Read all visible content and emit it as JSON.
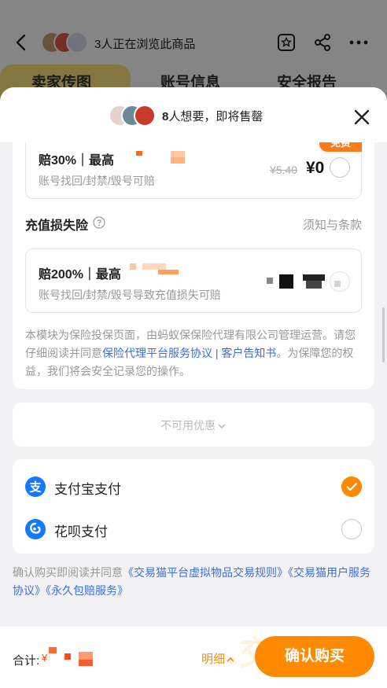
{
  "background_page": {
    "viewers_text": "3人正在浏览此商品",
    "tabs": [
      "卖家传图",
      "账号信息",
      "安全报告"
    ]
  },
  "sheet": {
    "header": {
      "want_count": "8",
      "want_text": "人想要，即将售罄"
    },
    "insurance": {
      "option1": {
        "title": "赔30%｜最高",
        "subtitle": "账号找回/封禁/毁号可赔",
        "badge": "免费",
        "old_price": "¥5.40",
        "new_price": "¥0"
      },
      "section_title": "充值损失险",
      "terms_link": "须知与条款",
      "option2": {
        "title": "赔200%｜最高",
        "subtitle": "账号找回/封禁/毁号导致充值损失可赔"
      },
      "notice_prefix": "本模块为保险投保页面，由蚂蚁保保险代理有限公司管理运营。请您仔细阅读并同意",
      "notice_link": "保险代理平台服务协议 | 客户告知书",
      "notice_suffix": "。为保障您的权益，我们将会安全记录您的操作。"
    },
    "coupon": {
      "label": "不可用优惠",
      "icon": "chevron-down-icon"
    },
    "payment": {
      "methods": [
        {
          "label": "支付宝支付",
          "icon": "alipay-icon",
          "selected": true
        },
        {
          "label": "花呗支付",
          "icon": "huabei-icon",
          "selected": false
        }
      ]
    },
    "agreement_prefix": "确认购买即阅读并同意",
    "agreement_links": "《交易猫平台虚拟物品交易规则》《交易猫用户服务协议》《永久包赔服务》",
    "bottom": {
      "total_label": "合计:",
      "currency": "¥",
      "detail_label": "明细",
      "confirm_label": "确认购买",
      "watermark": "交易猫"
    }
  },
  "colors": {
    "accent": "#ff8a00",
    "link": "#3a6fd8",
    "badge": "#ff7a1a"
  }
}
